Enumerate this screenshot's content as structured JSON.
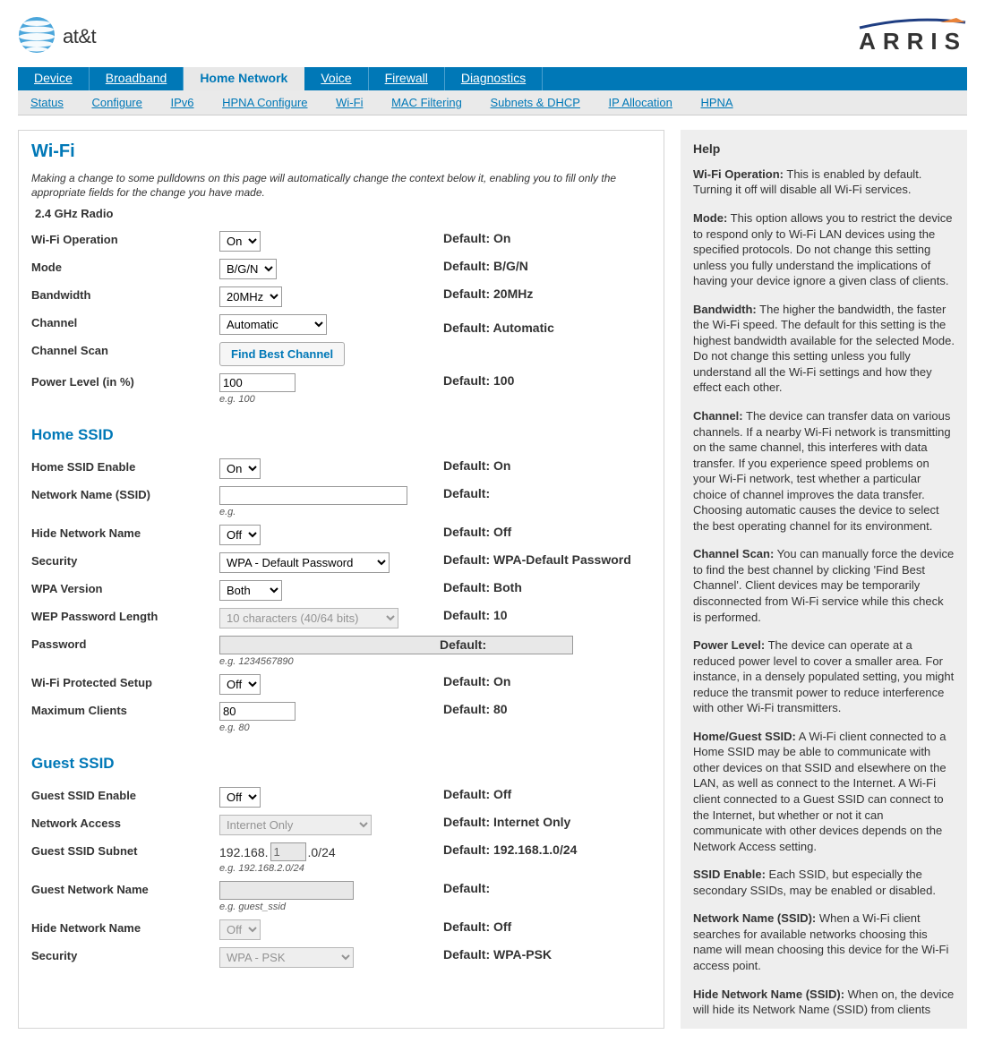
{
  "header": {
    "att_label": "at&t",
    "arris_label": "A R R I S"
  },
  "main_nav": [
    {
      "label": "Device",
      "active": false
    },
    {
      "label": "Broadband",
      "active": false
    },
    {
      "label": "Home Network",
      "active": true
    },
    {
      "label": "Voice",
      "active": false
    },
    {
      "label": "Firewall",
      "active": false
    },
    {
      "label": "Diagnostics",
      "active": false
    }
  ],
  "sub_nav": [
    "Status",
    "Configure",
    "IPv6",
    "HPNA Configure",
    "Wi-Fi",
    "MAC Filtering",
    "Subnets & DHCP",
    "IP Allocation",
    "HPNA"
  ],
  "page": {
    "title": "Wi-Fi",
    "desc": "Making a change to some pulldowns on this page will automatically change the context below it, enabling you to fill only the appropriate fields for the change you have made."
  },
  "radio": {
    "heading": "2.4 GHz Radio",
    "rows": {
      "operation": {
        "label": "Wi-Fi Operation",
        "value": "On",
        "default": "Default: On"
      },
      "mode": {
        "label": "Mode",
        "value": "B/G/N",
        "default": "Default: B/G/N"
      },
      "bandwidth": {
        "label": "Bandwidth",
        "value": "20MHz",
        "default": "Default: 20MHz"
      },
      "channel": {
        "label": "Channel",
        "value": "Automatic",
        "default": "Default: Automatic"
      },
      "scan": {
        "label": "Channel Scan",
        "button": "Find Best Channel"
      },
      "power": {
        "label": "Power Level (in %)",
        "value": "100",
        "hint": "e.g. 100",
        "default": "Default: 100"
      }
    }
  },
  "home": {
    "heading": "Home SSID",
    "rows": {
      "enable": {
        "label": "Home SSID Enable",
        "value": "On",
        "default": "Default: On"
      },
      "ssid": {
        "label": "Network Name (SSID)",
        "value": "",
        "hint": "e.g.",
        "default": "Default:"
      },
      "hide": {
        "label": "Hide Network Name",
        "value": "Off",
        "default": "Default: Off"
      },
      "security": {
        "label": "Security",
        "value": "WPA - Default Password",
        "default": "Default: WPA-Default Password"
      },
      "wpa": {
        "label": "WPA Version",
        "value": "Both",
        "default": "Default: Both"
      },
      "wep": {
        "label": "WEP Password Length",
        "value": "10 characters (40/64 bits)",
        "default": "Default: 10"
      },
      "password": {
        "label": "Password",
        "value": "",
        "hint": "e.g. 1234567890",
        "default": "Default:"
      },
      "wps": {
        "label": "Wi-Fi Protected Setup",
        "value": "Off",
        "default": "Default: On"
      },
      "max": {
        "label": "Maximum Clients",
        "value": "80",
        "hint": "e.g. 80",
        "default": "Default: 80"
      }
    }
  },
  "guest": {
    "heading": "Guest SSID",
    "rows": {
      "enable": {
        "label": "Guest SSID Enable",
        "value": "Off",
        "default": "Default: Off"
      },
      "access": {
        "label": "Network Access",
        "value": "Internet Only",
        "default": "Default: Internet Only"
      },
      "subnet": {
        "label": "Guest SSID Subnet",
        "prefix": "192.168.",
        "value": "1",
        "suffix": ".0/24",
        "hint": "e.g. 192.168.2.0/24",
        "default": "Default: 192.168.1.0/24"
      },
      "name": {
        "label": "Guest Network Name",
        "value": "",
        "hint": "e.g. guest_ssid",
        "default": "Default:"
      },
      "hide": {
        "label": "Hide Network Name",
        "value": "Off",
        "default": "Default: Off"
      },
      "security": {
        "label": "Security",
        "value": "WPA - PSK",
        "default": "Default: WPA-PSK"
      }
    }
  },
  "help": {
    "title": "Help",
    "items": [
      {
        "b": "Wi-Fi Operation:",
        "t": " This is enabled by default. Turning it off will disable all Wi-Fi services."
      },
      {
        "b": "Mode:",
        "t": " This option allows you to restrict the device to respond only to Wi-Fi LAN devices using the specified protocols. Do not change this setting unless you fully understand the implications of having your device ignore a given class of clients."
      },
      {
        "b": "Bandwidth:",
        "t": " The higher the bandwidth, the faster the Wi-Fi speed. The default for this setting is the highest bandwidth available for the selected Mode. Do not change this setting unless you fully understand all the Wi-Fi settings and how they effect each other."
      },
      {
        "b": "Channel:",
        "t": " The device can transfer data on various channels. If a nearby Wi-Fi network is transmitting on the same channel, this interferes with data transfer. If you experience speed problems on your Wi-Fi network, test whether a particular choice of channel improves the data transfer. Choosing automatic causes the device to select the best operating channel for its environment."
      },
      {
        "b": "Channel Scan:",
        "t": " You can manually force the device to find the best channel by clicking 'Find Best Channel'. Client devices may be temporarily disconnected from Wi-Fi service while this check is performed."
      },
      {
        "b": "Power Level:",
        "t": " The device can operate at a reduced power level to cover a smaller area. For instance, in a densely populated setting, you might reduce the transmit power to reduce interference with other Wi-Fi transmitters."
      },
      {
        "b": "Home/Guest SSID:",
        "t": " A Wi-Fi client connected to a Home SSID may be able to communicate with other devices on that SSID and elsewhere on the LAN, as well as connect to the Internet. A Wi-Fi client connected to a Guest SSID can connect to the Internet, but whether or not it can communicate with other devices depends on the Network Access setting."
      },
      {
        "b": "SSID Enable:",
        "t": " Each SSID, but especially the secondary SSIDs, may be enabled or disabled."
      },
      {
        "b": "Network Name (SSID):",
        "t": " When a Wi-Fi client searches for available networks choosing this name will mean choosing this device for the Wi-Fi access point."
      },
      {
        "b": "Hide Network Name (SSID):",
        "t": " When on, the device will hide its Network Name (SSID) from clients"
      }
    ]
  }
}
